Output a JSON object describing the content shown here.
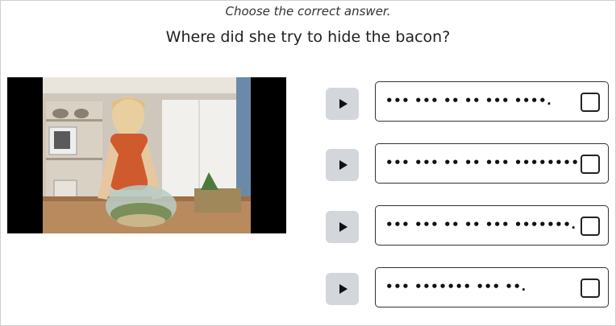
{
  "instruction": "Choose the correct answer.",
  "question": "Where did she try to hide the bacon?",
  "options": [
    {
      "text": "••• ••• •• •• ••• ••••.",
      "checked": false
    },
    {
      "text": "••• ••• •• •• ••• ••••••••.",
      "checked": false
    },
    {
      "text": "••• ••• •• •• ••• •••••••.",
      "checked": false
    },
    {
      "text": "••• ••••••• ••• ••.",
      "checked": false
    }
  ],
  "icons": {
    "play": "play-icon",
    "checkbox": "checkbox-icon"
  },
  "colors": {
    "play_button_bg": "#d3d6db",
    "option_border": "#333333"
  }
}
